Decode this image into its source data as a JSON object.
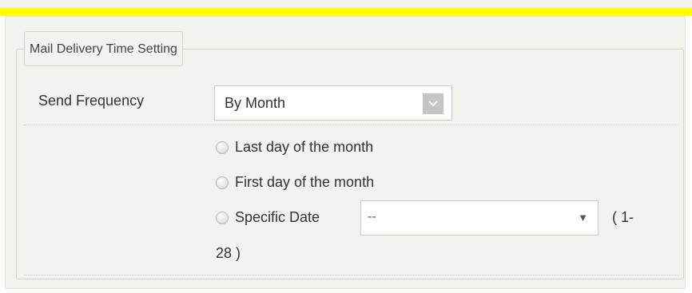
{
  "legend": "Mail Delivery Time Setting",
  "send_frequency": {
    "label": "Send Frequency",
    "selected": "By Month",
    "arrow_icon": "chevron-down-icon"
  },
  "options": [
    {
      "label": "Last day of the month",
      "checked": false
    },
    {
      "label": "First day of the month",
      "checked": false
    },
    {
      "label": "Specific Date",
      "checked": false
    }
  ],
  "specific_date": {
    "selected": "--",
    "arrow_icon": "triangle-down-icon",
    "range_prefix": "( 1-",
    "range_suffix": "28 )"
  },
  "colors": {
    "accent_bar": "#ffff00",
    "panel_bg": "#f1f3ef"
  }
}
